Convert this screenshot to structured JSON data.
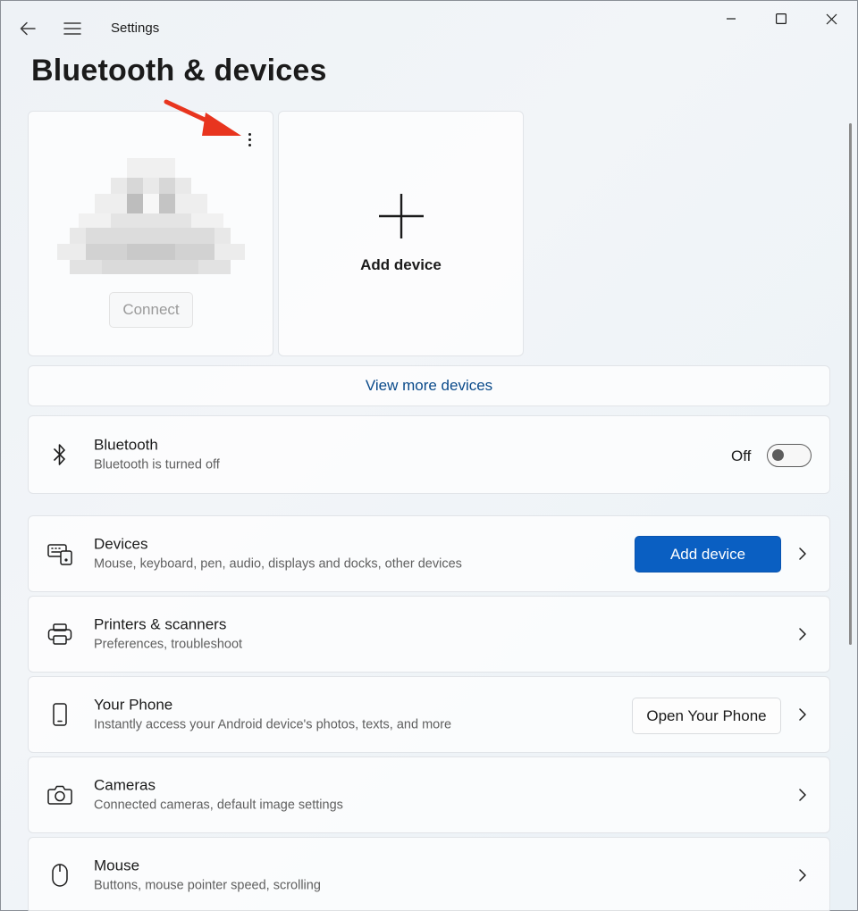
{
  "window": {
    "app_title": "Settings",
    "minimize_icon": "minimize-icon",
    "maximize_icon": "maximize-icon",
    "close_icon": "close-icon"
  },
  "page": {
    "title": "Bluetooth & devices"
  },
  "device_tiles": {
    "paired_device": {
      "connect_label": "Connect",
      "more_icon": "more-vertical-icon",
      "image": "pixelated-device-image"
    },
    "add_device": {
      "label": "Add device",
      "icon": "plus-icon"
    }
  },
  "view_more": {
    "label": "View more devices"
  },
  "bluetooth": {
    "title": "Bluetooth",
    "subtitle": "Bluetooth is turned off",
    "toggle_label": "Off",
    "toggle_on": false,
    "icon": "bluetooth-icon"
  },
  "rows": {
    "devices": {
      "title": "Devices",
      "subtitle": "Mouse, keyboard, pen, audio, displays and docks, other devices",
      "button": "Add device",
      "icon": "devices-icon"
    },
    "printers": {
      "title": "Printers & scanners",
      "subtitle": "Preferences, troubleshoot",
      "icon": "printer-icon"
    },
    "phone": {
      "title": "Your Phone",
      "subtitle": "Instantly access your Android device's photos, texts, and more",
      "button": "Open Your Phone",
      "icon": "phone-icon"
    },
    "cameras": {
      "title": "Cameras",
      "subtitle": "Connected cameras, default image settings",
      "icon": "camera-icon"
    },
    "mouse": {
      "title": "Mouse",
      "subtitle": "Buttons, mouse pointer speed, scrolling",
      "icon": "mouse-icon"
    }
  },
  "colors": {
    "accent": "#0a5fc2",
    "annotation_arrow": "#e8351f",
    "link": "#0a4a8a"
  }
}
